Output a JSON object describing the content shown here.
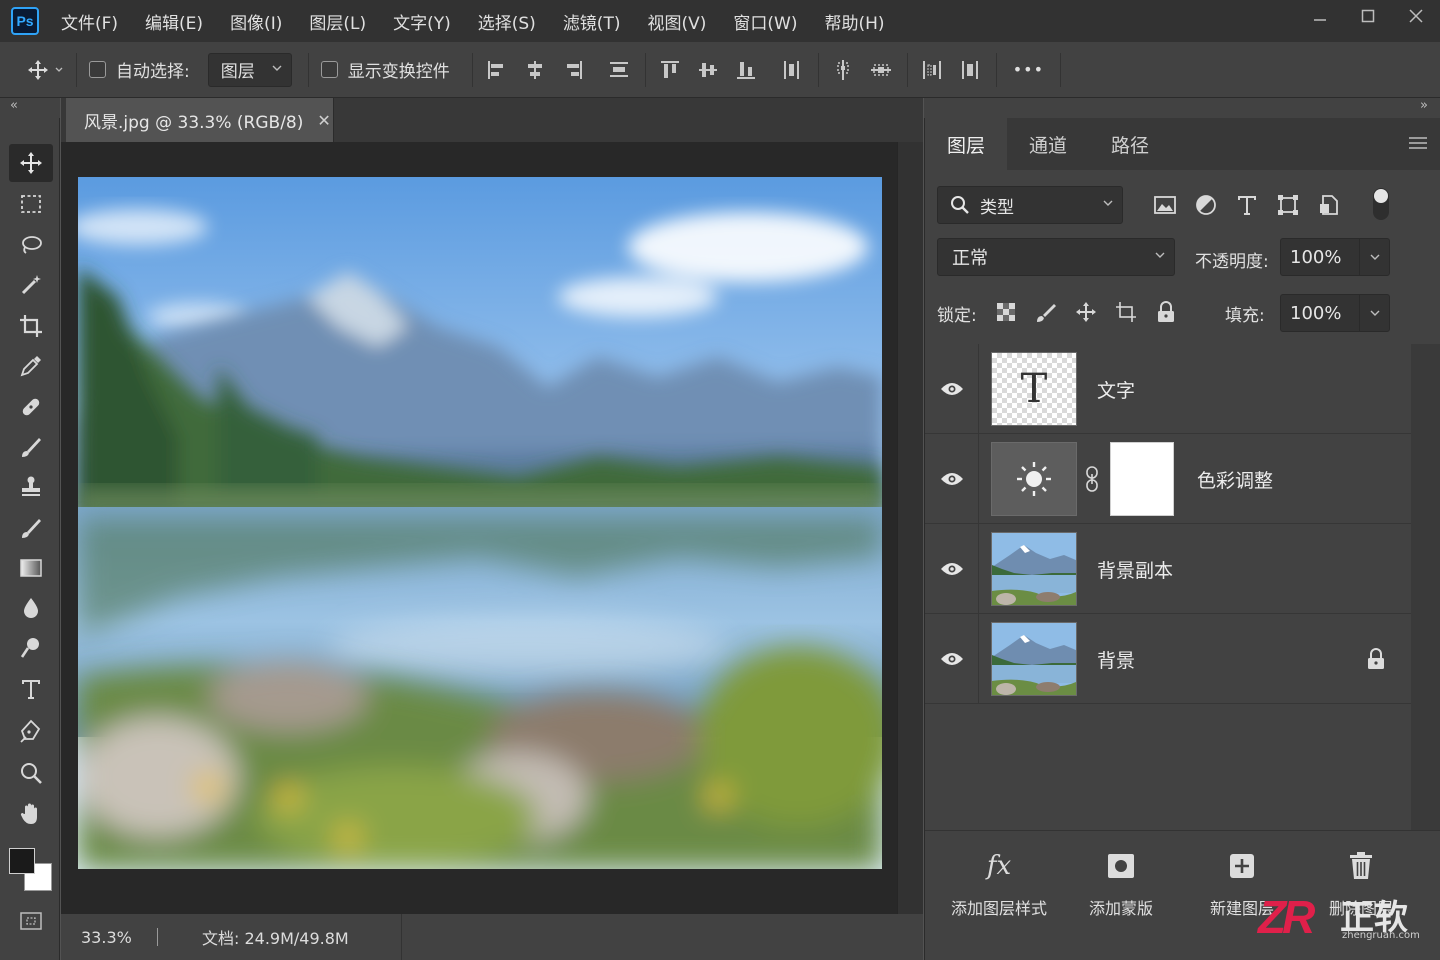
{
  "app": {
    "logo": "Ps",
    "window_controls": [
      "minimize-icon",
      "maximize-icon",
      "close-icon"
    ]
  },
  "menu": [
    "文件(F)",
    "编辑(E)",
    "图像(I)",
    "图层(L)",
    "文字(Y)",
    "选择(S)",
    "滤镜(T)",
    "视图(V)",
    "窗口(W)",
    "帮助(H)"
  ],
  "options": {
    "auto_select_label": "自动选择:",
    "auto_select_value": "图层",
    "show_transform_label": "显示变换控件",
    "more": "•••"
  },
  "collapse": {
    "left": "«",
    "right": "»"
  },
  "document": {
    "tab_title": "风景.jpg @ 33.3% (RGB/8)",
    "tab_close": "✕",
    "zoom": "33.3%",
    "doc_size": "文档: 24.9M/49.8M"
  },
  "tools": [
    "move-tool",
    "marquee-tool",
    "lasso-tool",
    "magic-wand-tool",
    "crop-tool",
    "eyedropper-tool",
    "healing-brush-tool",
    "brush-tool",
    "clone-stamp-tool",
    "history-brush-tool",
    "gradient-tool",
    "blur-tool",
    "dodge-tool",
    "type-tool",
    "pen-tool",
    "zoom-tool",
    "hand-tool"
  ],
  "colors": {
    "foreground": "#1a1a1a",
    "background": "#ffffff",
    "accent": "#31a8ff"
  },
  "panel": {
    "tabs": [
      "图层",
      "通道",
      "路径"
    ],
    "active_tab": "图层",
    "filter_label": "类型",
    "blend_mode": "正常",
    "opacity_label": "不透明度:",
    "opacity_value": "100%",
    "lock_label": "锁定:",
    "fill_label": "填充:",
    "fill_value": "100%"
  },
  "layers": [
    {
      "name": "文字",
      "type": "text",
      "thumb_glyph": "T",
      "visible": true
    },
    {
      "name": "色彩调整",
      "type": "adjustment",
      "visible": true
    },
    {
      "name": "背景副本",
      "type": "image",
      "visible": true
    },
    {
      "name": "背景",
      "type": "image",
      "visible": true,
      "locked": true
    }
  ],
  "panel_actions": {
    "fx_glyph": "fx",
    "add_style": "添加图层样式",
    "add_mask": "添加蒙版",
    "new_layer": "新建图层",
    "delete_layer": "删除图层"
  },
  "watermark": {
    "logo": "ZR",
    "text": "正软",
    "url": "zhengruan.com"
  }
}
